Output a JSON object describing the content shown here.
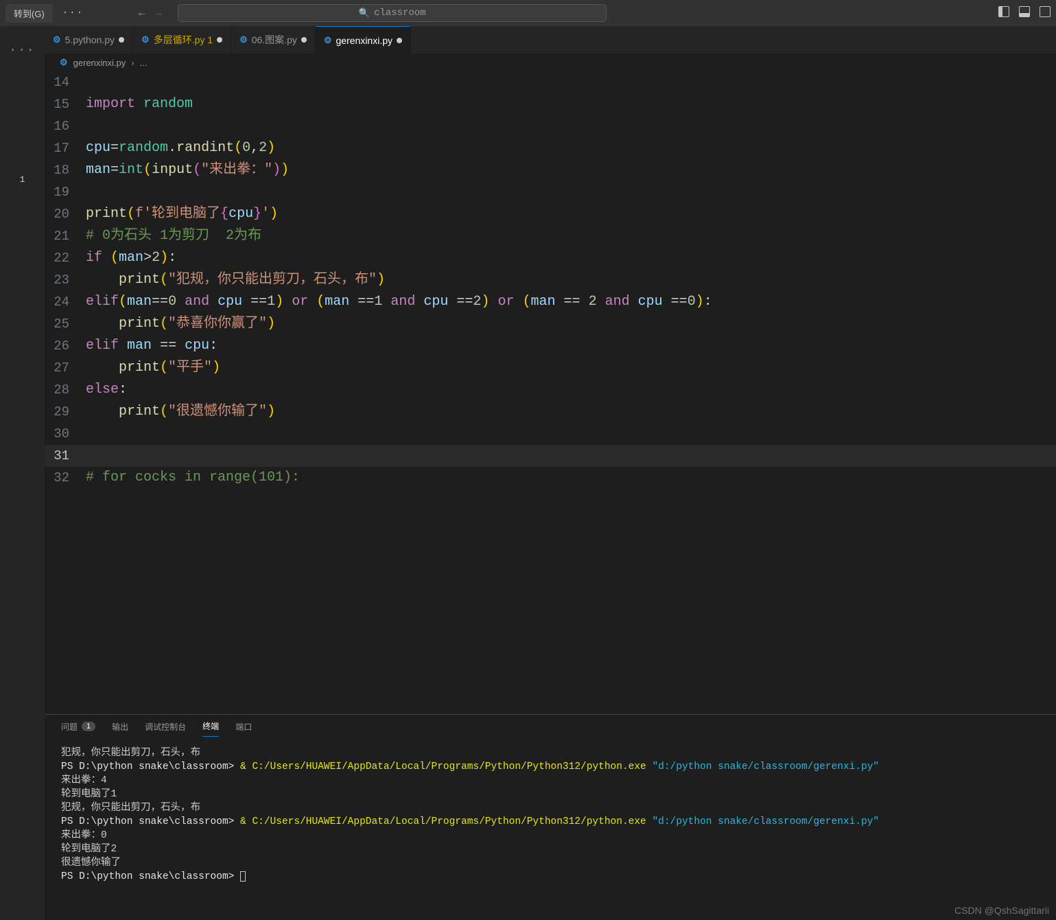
{
  "titlebar": {
    "menu_label": "转到(G)",
    "search_text": "classroom"
  },
  "sidebar": {
    "badge": "1"
  },
  "tabs": [
    {
      "icon": "py",
      "label": "5.python.py",
      "dirty": true,
      "active": false,
      "warn": false
    },
    {
      "icon": "py",
      "label": "多层循环.py 1",
      "dirty": true,
      "active": false,
      "warn": true
    },
    {
      "icon": "py",
      "label": "06.图案.py",
      "dirty": true,
      "active": false,
      "warn": false
    },
    {
      "icon": "py",
      "label": "gerenxinxi.py",
      "dirty": true,
      "active": true,
      "warn": false
    }
  ],
  "breadcrumb": {
    "file": "gerenxinxi.py",
    "sep": "›",
    "more": "..."
  },
  "code_lines": {
    "start": 14,
    "current": 31
  },
  "panel": {
    "tabs": {
      "problems": "问题",
      "problems_count": "1",
      "output": "输出",
      "debug": "调试控制台",
      "terminal": "终端",
      "ports": "端口"
    }
  },
  "terminal": {
    "l0": "犯规，你只能出剪刀，石头，布",
    "l1_pre": "PS D:\\python snake\\classroom> ",
    "l1_amp": "&",
    "l1_exe": " C:/Users/HUAWEI/AppData/Local/Programs/Python/Python312/python.exe ",
    "l1_path": "\"d:/python snake/classroom/gerenxi.py\"",
    "l2": "来出拳：4",
    "l3": "轮到电脑了1",
    "l4": "犯规，你只能出剪刀，石头，布",
    "l5_pre": "PS D:\\python snake\\classroom> ",
    "l6": "来出拳：0",
    "l7": "轮到电脑了2",
    "l8": "很遗憾你输了",
    "l9_pre": "PS D:\\python snake\\classroom> "
  },
  "watermark": "CSDN @QshSagittarii",
  "code_text": {
    "import": "import",
    "random": "random",
    "cpu": "cpu",
    "man": "man",
    "eq": "=",
    "dot": ".",
    "randint": "randint",
    "int": "int",
    "input": "input",
    "s_input": "\"来出拳：\"",
    "print": "print",
    "fstr_open": "f'",
    "fstr_txt": "轮到电脑了",
    "fstr_close": "'",
    "cmt1": "# 0为石头 1为剪刀  2为布",
    "if": "if",
    "elif": "elif",
    "else": "else",
    "and": "and",
    "or": "or",
    "s_foul": "\"犯规，你只能出剪刀，石头，布\"",
    "s_win": "\"恭喜你你赢了\"",
    "s_tie": "\"平手\"",
    "s_lose": "\"很遗憾你输了\"",
    "cmt2": "# for cocks in range(101):",
    "n0": "0",
    "n1": "1",
    "n2": "2",
    "gt": ">",
    "eqeq": "==",
    "colon": ":",
    "comma": ",",
    "lp": "(",
    "rp": ")",
    "lb": "{",
    "rb": "}",
    "sp": " "
  }
}
